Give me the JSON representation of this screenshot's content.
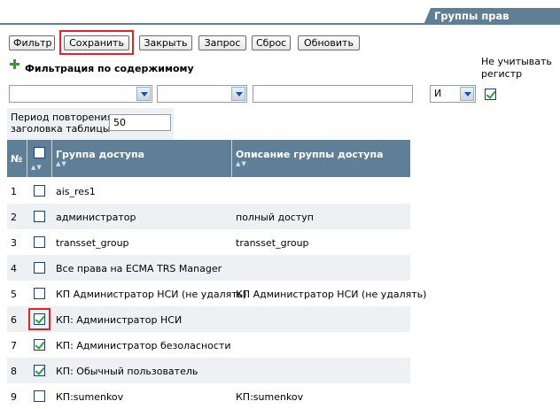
{
  "header": {
    "title": "Группы прав доступа"
  },
  "toolbar": {
    "buttons": [
      "Фильтр",
      "Сохранить",
      "Закрыть",
      "Запрос",
      "Сброс",
      "Обновить"
    ]
  },
  "filter": {
    "title": "Фильтрация по содержимому",
    "ignore_case_label_1": "Не учитывать",
    "ignore_case_label_2": "регистр",
    "field_select": "",
    "operator_select": "",
    "value_input": "",
    "logic_select": "И",
    "ignore_case_checked": true
  },
  "period": {
    "label_1": "Период повторения",
    "label_2": "заголовка таблицы",
    "value": "50"
  },
  "table": {
    "columns": [
      "№",
      "",
      "Группа доступа",
      "Описание группы доступа"
    ],
    "rows": [
      {
        "num": "1",
        "checked": false,
        "group": "ais_res1",
        "desc": ""
      },
      {
        "num": "2",
        "checked": false,
        "group": "администратор",
        "desc": "полный доступ"
      },
      {
        "num": "3",
        "checked": false,
        "group": "transset_group",
        "desc": "transset_group"
      },
      {
        "num": "4",
        "checked": false,
        "group": "Все права на ECMA TRS Manager",
        "desc": ""
      },
      {
        "num": "5",
        "checked": false,
        "group": "КП Администратор НСИ (не удалять)",
        "desc": "КП Администратор НСИ (не удалять)"
      },
      {
        "num": "6",
        "checked": true,
        "group": "КП: Администратор НСИ",
        "desc": ""
      },
      {
        "num": "7",
        "checked": true,
        "group": "КП: Администратор безоласности",
        "desc": ""
      },
      {
        "num": "8",
        "checked": true,
        "group": "КП: Обычный пользователь",
        "desc": ""
      },
      {
        "num": "9",
        "checked": false,
        "group": "КП:sumenkov",
        "desc": "КП:sumenkov"
      }
    ]
  },
  "colors": {
    "header_bg": "#5e7f95",
    "highlight": "#e0242a",
    "row_alt": "#eef1f4",
    "check": "#2f9e3a"
  }
}
